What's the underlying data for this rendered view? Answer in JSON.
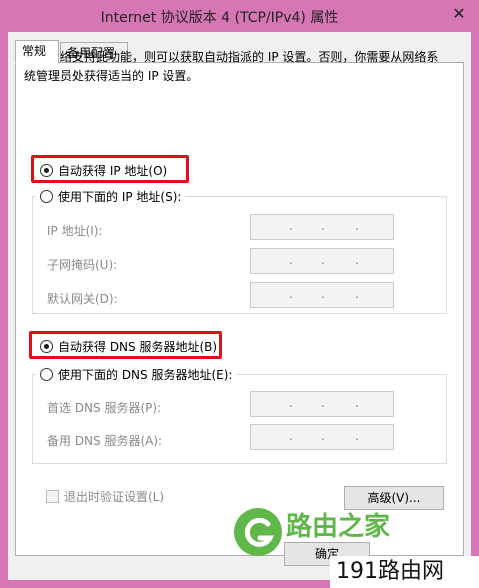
{
  "window": {
    "title": "Internet 协议版本 4 (TCP/IPv4) 属性",
    "close_glyph": "✕"
  },
  "tabs": [
    {
      "label": "常规",
      "active": true
    },
    {
      "label": "备用配置",
      "active": false
    }
  ],
  "description": "如果网络支持此功能，则可以获取自动指派的 IP 设置。否则，你需要从网络系统管理员处获得适当的 IP 设置。",
  "ip_section": {
    "auto_label": "自动获得 IP 地址(O)",
    "auto_selected": true,
    "manual_label": "使用下面的 IP 地址(S):",
    "fields": [
      {
        "label": "IP 地址(I):",
        "value": ". . ."
      },
      {
        "label": "子网掩码(U):",
        "value": ". . ."
      },
      {
        "label": "默认网关(D):",
        "value": ". . ."
      }
    ]
  },
  "dns_section": {
    "auto_label": "自动获得 DNS 服务器地址(B)",
    "auto_selected": true,
    "manual_label": "使用下面的 DNS 服务器地址(E):",
    "fields": [
      {
        "label": "首选 DNS 服务器(P):",
        "value": ". . ."
      },
      {
        "label": "备用 DNS 服务器(A):",
        "value": ". . ."
      }
    ]
  },
  "validate_checkbox": {
    "label": "退出时验证设置(L)",
    "checked": false
  },
  "buttons": {
    "advanced": "高级(V)...",
    "ok": "确定"
  },
  "watermark": {
    "brand": "路由之家",
    "corner": "191路由网"
  },
  "colors": {
    "highlight_box": "#e0101a",
    "window_frame": "#d776b5",
    "watermark_green": "#61b84a"
  }
}
